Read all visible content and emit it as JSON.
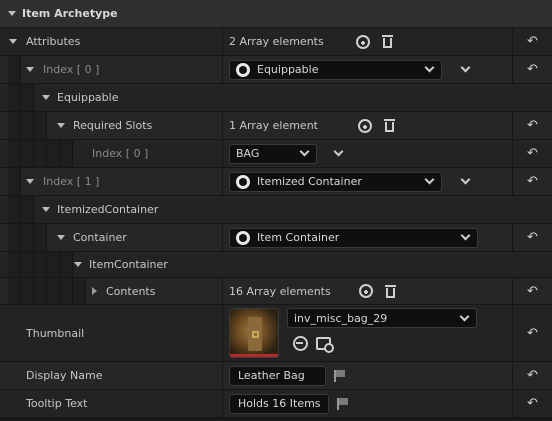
{
  "header": {
    "title": "Item Archetype"
  },
  "attributes": {
    "label": "Attributes",
    "count": "2 Array elements",
    "index0": {
      "label": "Index [ 0 ]",
      "class": "Equippable",
      "group": "Equippable",
      "required_slots": {
        "label": "Required Slots",
        "count": "1 Array element",
        "item": {
          "label": "Index [ 0 ]",
          "value": "BAG"
        }
      }
    },
    "index1": {
      "label": "Index [ 1 ]",
      "class": "Itemized Container",
      "group": "ItemizedContainer",
      "container": {
        "label": "Container",
        "class": "Item Container",
        "group": "ItemContainer",
        "contents": {
          "label": "Contents",
          "count": "16 Array elements"
        }
      }
    }
  },
  "thumbnail": {
    "label": "Thumbnail",
    "asset": "inv_misc_bag_29"
  },
  "display_name": {
    "label": "Display Name",
    "value": "Leather Bag"
  },
  "tooltip_text": {
    "label": "Tooltip Text",
    "value": "Holds 16 Items"
  },
  "colors": {
    "background": "#1a1a1a",
    "row": "#232323",
    "input": "#0f0f0f",
    "text": "#c8c8c8"
  }
}
